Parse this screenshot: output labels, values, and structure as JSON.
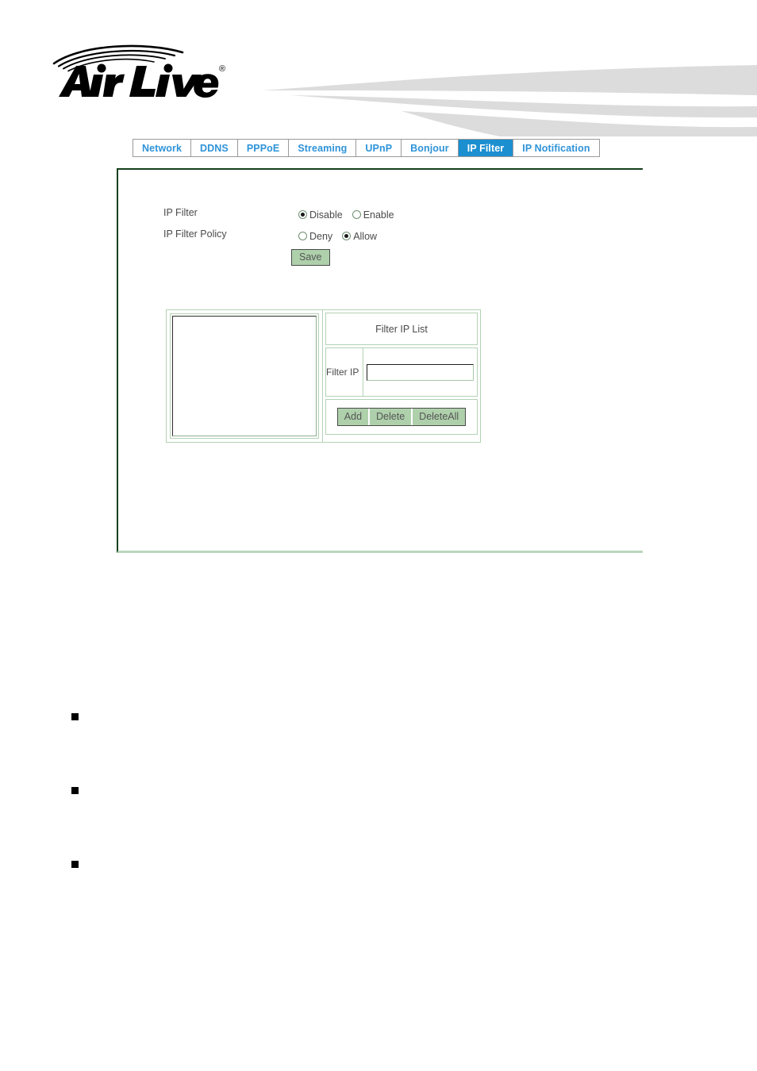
{
  "header": {
    "brand_name": "Air Live",
    "brand_trademark": "®",
    "logo_icon": "airlive-wifi-waves-logo",
    "swoosh_icon": "header-swoosh-graphic"
  },
  "tabs": [
    {
      "id": "network",
      "label": "Network",
      "active": false
    },
    {
      "id": "ddns",
      "label": "DDNS",
      "active": false
    },
    {
      "id": "pppoe",
      "label": "PPPoE",
      "active": false
    },
    {
      "id": "streaming",
      "label": "Streaming",
      "active": false
    },
    {
      "id": "upnp",
      "label": "UPnP",
      "active": false
    },
    {
      "id": "bonjour",
      "label": "Bonjour",
      "active": false
    },
    {
      "id": "ip-filter",
      "label": "IP Filter",
      "active": true
    },
    {
      "id": "ip-notification",
      "label": "IP Notification",
      "active": false
    }
  ],
  "form": {
    "ip_filter": {
      "label": "IP Filter",
      "options": [
        {
          "value": "disable",
          "label": "Disable",
          "checked": true
        },
        {
          "value": "enable",
          "label": "Enable",
          "checked": false
        }
      ]
    },
    "ip_filter_policy": {
      "label": "IP Filter Policy",
      "options": [
        {
          "value": "deny",
          "label": "Deny",
          "checked": false
        },
        {
          "value": "allow",
          "label": "Allow",
          "checked": true
        }
      ]
    },
    "save_label": "Save"
  },
  "filter_list": {
    "title": "Filter IP List",
    "entries": [],
    "filter_ip_label": "Filter IP",
    "filter_ip_value": "",
    "filter_ip_placeholder": "",
    "buttons": {
      "add": "Add",
      "delete": "Delete",
      "delete_all": "DeleteAll"
    }
  },
  "notes": [
    {
      "bullet_icon": "square-bullet-icon",
      "text": ""
    },
    {
      "bullet_icon": "square-bullet-icon",
      "text": ""
    },
    {
      "bullet_icon": "square-bullet-icon",
      "text": ""
    }
  ],
  "colors": {
    "tab_text": "#2e93d8",
    "tab_active_bg": "#1b8fd0",
    "panel_border_dark": "#13401b",
    "panel_border_light": "#b9d6bc",
    "button_bg": "#aed0ab",
    "swoosh_gray": "#dcdcdc"
  }
}
